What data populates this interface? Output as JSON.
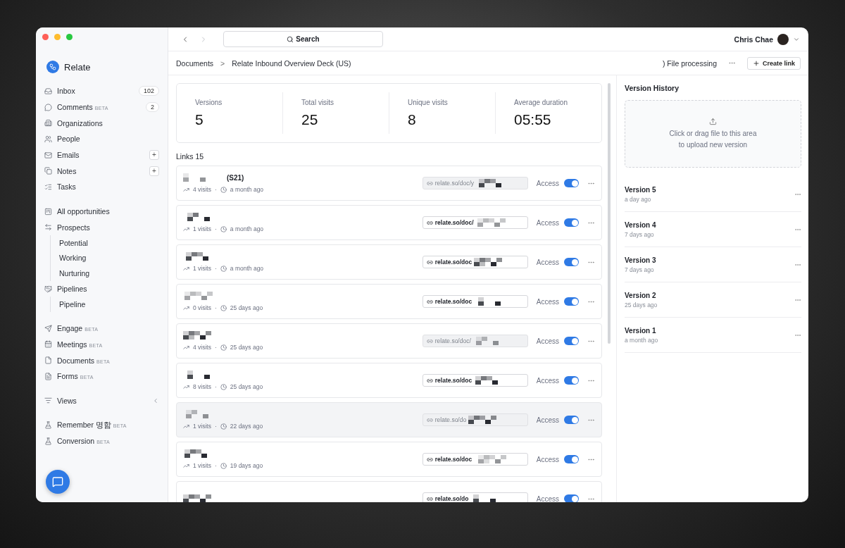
{
  "app": {
    "name": "Relate"
  },
  "sidebar": {
    "sections": [
      {
        "items": [
          {
            "label": "Inbox",
            "count": "102"
          },
          {
            "label": "Comments",
            "tag": "BETA",
            "count": "2"
          },
          {
            "label": "Organizations"
          },
          {
            "label": "People"
          },
          {
            "label": "Emails",
            "add": "+"
          },
          {
            "label": "Notes",
            "add": "+"
          },
          {
            "label": "Tasks"
          }
        ]
      },
      {
        "items": [
          {
            "label": "All opportunities"
          },
          {
            "label": "Prospects",
            "children": [
              {
                "label": "Potential"
              },
              {
                "label": "Working"
              },
              {
                "label": "Nurturing"
              }
            ]
          },
          {
            "label": "Pipelines",
            "children": [
              {
                "label": "Pipeline"
              }
            ]
          }
        ]
      },
      {
        "items": [
          {
            "label": "Engage",
            "tag": "BETA"
          },
          {
            "label": "Meetings",
            "tag": "BETA"
          },
          {
            "label": "Documents",
            "tag": "BETA"
          },
          {
            "label": "Forms",
            "tag": "BETA"
          }
        ]
      },
      {
        "items": [
          {
            "label": "Views",
            "expanded": false
          }
        ]
      },
      {
        "items": [
          {
            "label": "Remember 명함",
            "tag": "BETA"
          },
          {
            "label": "Conversion",
            "tag": "BETA"
          }
        ]
      }
    ]
  },
  "topbar": {
    "search": {
      "label": "Search"
    },
    "user": {
      "name": "Chris Chae"
    }
  },
  "breadcrumb": [
    "Documents",
    "Relate Inbound Overview Deck (US)"
  ],
  "separator": ">",
  "status": ") File processing",
  "create_button": "Create link",
  "stats": [
    {
      "label": "Versions",
      "value": "5"
    },
    {
      "label": "Total visits",
      "value": "25"
    },
    {
      "label": "Unique visits",
      "value": "8"
    },
    {
      "label": "Average duration",
      "value": "05:55"
    }
  ],
  "links_heading": "Links 15",
  "meta_separator": "·",
  "links": [
    {
      "title": "(S21)",
      "visits": "4 visits",
      "time": "a month ago",
      "url": "relate.so/doc/y",
      "disabled": true,
      "highlighted": false,
      "access_label": "Access",
      "access_on": true
    },
    {
      "visits": "1 visits",
      "time": "a month ago",
      "url": "relate.so/doc/",
      "disabled": false,
      "highlighted": false,
      "access_label": "Access",
      "access_on": true
    },
    {
      "visits": "1 visits",
      "time": "a month ago",
      "url": "relate.so/doc",
      "disabled": false,
      "highlighted": false,
      "access_label": "Access",
      "access_on": true
    },
    {
      "visits": "0 visits",
      "time": "25 days ago",
      "url": "relate.so/doc",
      "disabled": false,
      "highlighted": false,
      "access_label": "Access",
      "access_on": true
    },
    {
      "visits": "4 visits",
      "time": "25 days ago",
      "url": "relate.so/doc/",
      "disabled": true,
      "highlighted": false,
      "access_label": "Access",
      "access_on": true
    },
    {
      "visits": "8 visits",
      "time": "25 days ago",
      "url": "relate.so/doc",
      "disabled": false,
      "highlighted": false,
      "access_label": "Access",
      "access_on": true
    },
    {
      "visits": "1 visits",
      "time": "22 days ago",
      "url": "relate.so/do",
      "disabled": true,
      "highlighted": true,
      "access_label": "Access",
      "access_on": true
    },
    {
      "visits": "1 visits",
      "time": "19 days ago",
      "url": "relate.so/doc",
      "disabled": false,
      "highlighted": false,
      "access_label": "Access",
      "access_on": true
    },
    {
      "url": "relate.so/do",
      "disabled": false,
      "highlighted": false,
      "access_label": "Access",
      "access_on": true
    }
  ],
  "version_history": {
    "title": "Version History",
    "upload_lines": [
      "Click or drag file to this area",
      "to upload new version"
    ],
    "versions": [
      {
        "name": "Version 5",
        "time": "a day ago"
      },
      {
        "name": "Version 4",
        "time": "7 days ago"
      },
      {
        "name": "Version 3",
        "time": "7 days ago"
      },
      {
        "name": "Version 2",
        "time": "25 days ago"
      },
      {
        "name": "Version 1",
        "time": "a month ago"
      }
    ]
  }
}
